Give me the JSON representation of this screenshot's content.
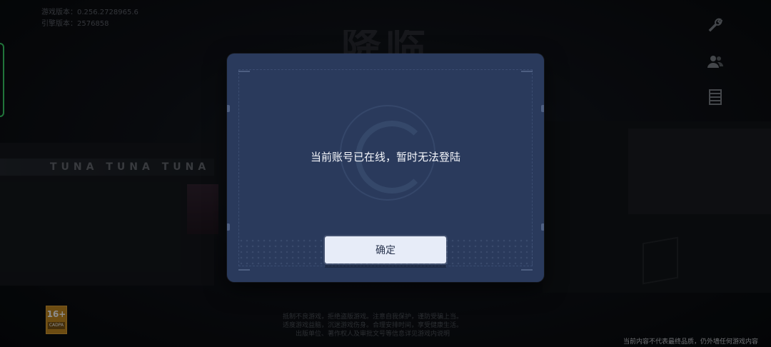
{
  "app": {
    "version_label": "游戏版本：0.256.2728965.6",
    "engine_label": "引擎版本：2576858"
  },
  "background": {
    "title": "降临",
    "sign_text": "TUNA TUNA TUNA"
  },
  "dialog": {
    "message": "当前账号已在线，暂时无法登陆",
    "confirm_label": "确定"
  },
  "rating": {
    "age": "16+",
    "caption": "CADPA"
  },
  "footer": {
    "legal_lines": [
      "抵制不良游戏，拒绝盗版游戏。注意自我保护，谨防受骗上当。",
      "适度游戏益脑，沉迷游戏伤身。合理安排时间，享受健康生活。",
      "出版单位、著作权人及审批文号等信息详见游戏内说明"
    ],
    "disclaimer": "当前内容不代表最终品质，仍外墙任何游戏内容"
  },
  "colors": {
    "dialog_bg": "#2a3a5c",
    "button_bg": "#e7ecf8",
    "accent_green": "#3bd36a"
  },
  "icons": {
    "tools": "wrench-icon",
    "friends": "friends-icon",
    "notice": "notice-list-icon"
  }
}
